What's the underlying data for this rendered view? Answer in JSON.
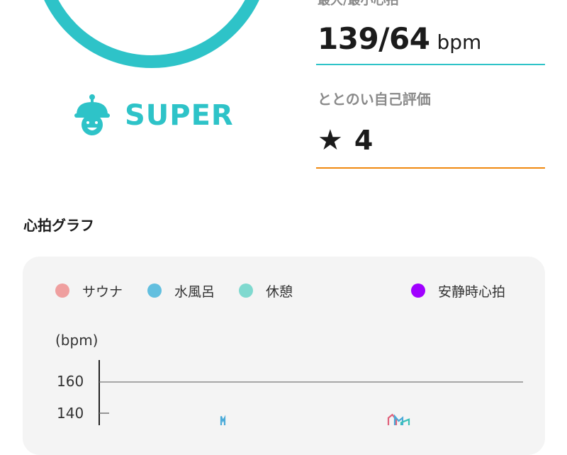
{
  "summary": {
    "max_min_label": "最大/最小心拍",
    "max_min_value": "139/64",
    "max_min_unit": "bpm",
    "rating_label": "ととのい自己評価",
    "rating_star": "★",
    "rating_value": "4",
    "level_label": "SUPER"
  },
  "graph": {
    "title": "心拍グラフ",
    "y_unit": "(bpm)",
    "legend": [
      {
        "label": "サウナ",
        "color": "#ef9f9f"
      },
      {
        "label": "水風呂",
        "color": "#62bfdf"
      },
      {
        "label": "休憩",
        "color": "#7fd9cf"
      },
      {
        "label": "安静時心拍",
        "color": "#a000ff"
      }
    ]
  },
  "colors": {
    "accent_teal": "#2ec3c8",
    "accent_orange": "#f0890f",
    "sauna_line": "#e0607a",
    "water_line": "#4aaad8",
    "rest_line": "#3bc1b8"
  },
  "chart_data": {
    "type": "line",
    "title": "",
    "xlabel": "",
    "ylabel": "(bpm)",
    "y_ticks": [
      "160",
      "140"
    ],
    "ylim": [
      120,
      170
    ],
    "series": [
      {
        "name": "サウナ",
        "points": [
          [
            0,
            137
          ],
          [
            1,
            139
          ],
          [
            2,
            136
          ]
        ]
      },
      {
        "name": "水風呂",
        "points": [
          [
            0,
            138
          ],
          [
            1,
            135
          ],
          [
            2,
            137
          ]
        ]
      },
      {
        "name": "休憩",
        "points": [
          [
            0,
            134
          ],
          [
            1,
            136
          ]
        ]
      }
    ]
  }
}
